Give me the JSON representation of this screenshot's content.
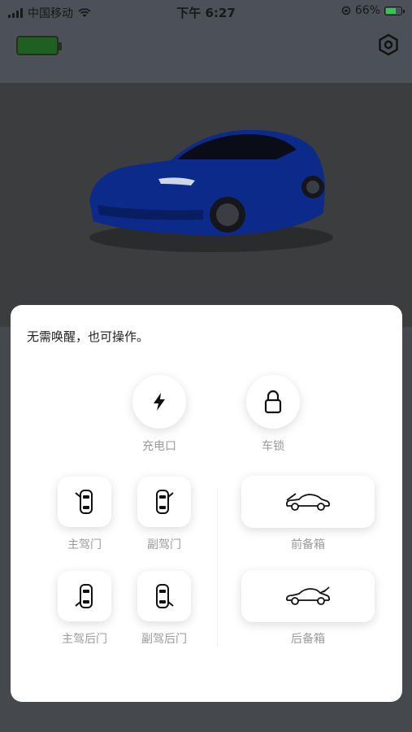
{
  "status_bar": {
    "carrier": "中国移动",
    "time": "下午 6:27",
    "battery_percent": "66%"
  },
  "header": {
    "battery_icon": "car-battery-icon",
    "settings_icon": "settings-hexagon-icon"
  },
  "sheet": {
    "title": "无需唤醒，也可操作。",
    "charge_port": {
      "label": "充电口",
      "icon": "lightning-icon"
    },
    "car_lock": {
      "label": "车锁",
      "icon": "lock-icon"
    },
    "driver_door": {
      "label": "主驾门",
      "icon": "car-door-left-icon"
    },
    "passenger_door": {
      "label": "副驾门",
      "icon": "car-door-right-icon"
    },
    "frunk": {
      "label": "前备箱",
      "icon": "car-frunk-icon"
    },
    "driver_rear_door": {
      "label": "主驾后门",
      "icon": "car-rear-door-left-icon"
    },
    "passenger_rear_door": {
      "label": "副驾后门",
      "icon": "car-rear-door-right-icon"
    },
    "trunk": {
      "label": "后备箱",
      "icon": "car-trunk-icon"
    }
  },
  "colors": {
    "overlay_bg": "#45484c",
    "sheet_bg": "#ffffff",
    "label_gray": "#9a9a9a",
    "battery_green": "#1f5f21",
    "car_blue": "#0c2a8a"
  }
}
